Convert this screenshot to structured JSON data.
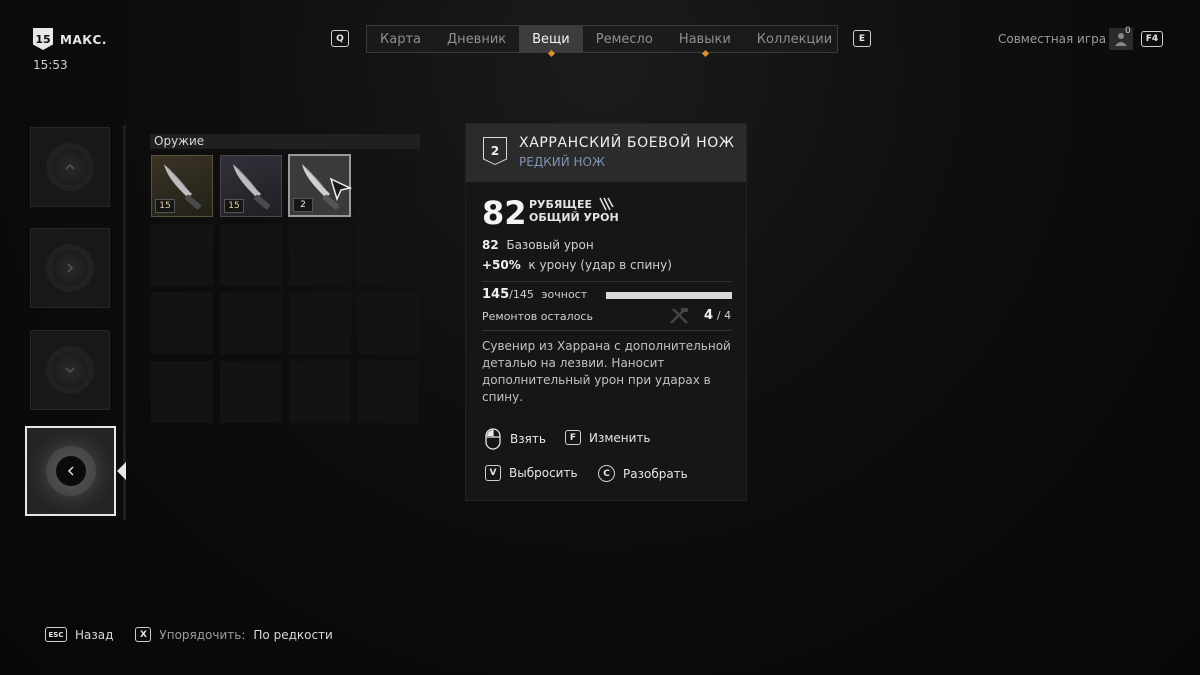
{
  "player": {
    "level": "15",
    "level_label": "МАКС.",
    "time": "15:53"
  },
  "nav": {
    "left_key": "Q",
    "right_key": "E",
    "tabs": [
      {
        "label": "Карта"
      },
      {
        "label": "Дневник"
      },
      {
        "label": "Вещи"
      },
      {
        "label": "Ремесло"
      },
      {
        "label": "Навыки"
      },
      {
        "label": "Коллекции"
      }
    ],
    "active_tab": "Вещи"
  },
  "coop": {
    "label": "Совместная игра",
    "count": "0",
    "key": "F4"
  },
  "inventory": {
    "section_label": "Оружие",
    "items": [
      {
        "level": "15",
        "rarity": "gold"
      },
      {
        "level": "15",
        "rarity": "purple"
      },
      {
        "level": "2",
        "rarity": "selected"
      }
    ]
  },
  "detail": {
    "level": "2",
    "name": "ХАРРАНСКИЙ БОЕВОЙ НОЖ",
    "subtitle": "РЕДКИЙ НОЖ",
    "damage_value": "82",
    "damage_type": "РУБЯЩЕЕ",
    "damage_label": "ОБЩИЙ УРОН",
    "base_value": "82",
    "base_label": "Базовый урон",
    "bonus_value": "+50%",
    "bonus_label": "к урону (удар в спину)",
    "durability_current": "145",
    "durability_max": "/145",
    "durability_label": "эочност",
    "durability_fraction": 1.0,
    "repairs_label": "Ремонтов осталось",
    "repairs_value": "4",
    "repairs_max": "/ 4",
    "description": "Сувенир из Харрана с дополнительной деталью на лезвии. Наносит дополнительный урон при ударах в спину.",
    "actions": {
      "take": "Взять",
      "modify_key": "F",
      "modify": "Изменить",
      "drop_key": "V",
      "drop": "Выбросить",
      "dismantle_key": "C",
      "dismantle": "Разобрать"
    }
  },
  "footer": {
    "back_key": "ESC",
    "back": "Назад",
    "sort_key": "X",
    "sort_label": "Упорядочить:",
    "sort_value": "По редкости"
  }
}
